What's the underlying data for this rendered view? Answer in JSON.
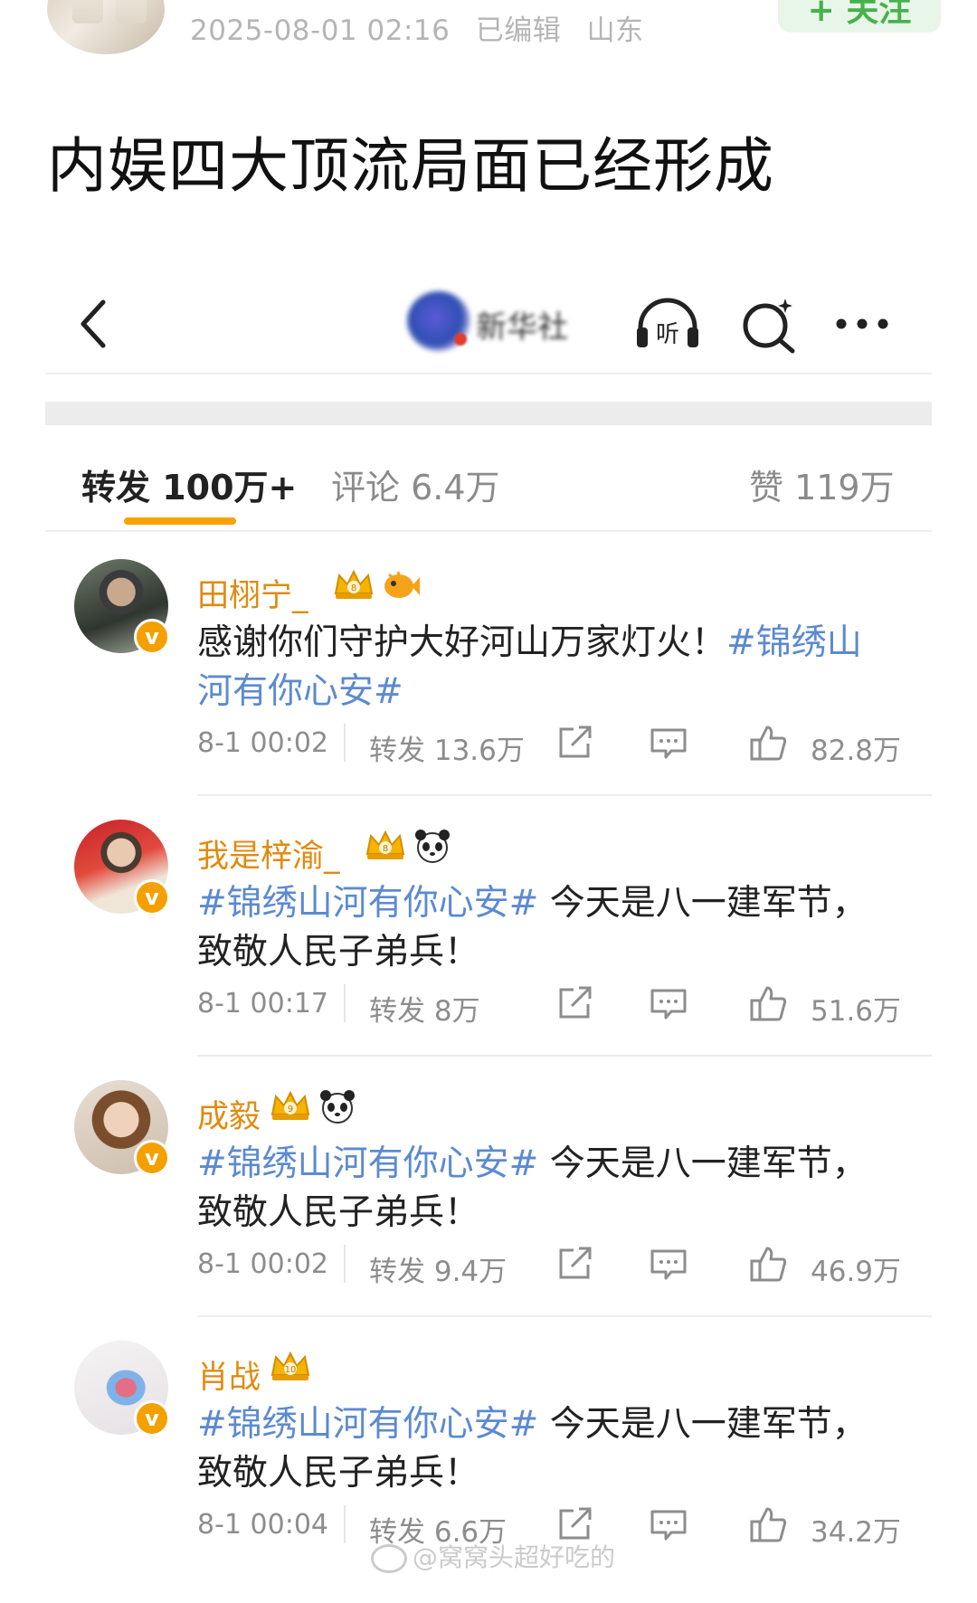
{
  "post": {
    "timestamp": "2025-08-01 02:16",
    "edited": "已编辑",
    "location": "山东",
    "follow_label": "+ 关注",
    "title": "内娱四大顶流局面已经形成"
  },
  "embedded_nav": {
    "account_name": "新华社",
    "listen_label": "听"
  },
  "tabs": {
    "repost": "转发 100万+",
    "comment": "评论 6.4万",
    "like": "赞 119万"
  },
  "reposts": [
    {
      "username": "田栩宁_",
      "level": "8",
      "verified_mark": "v",
      "text_parts": [
        {
          "text": "感谢你们守护大好河山万家灯火！",
          "is_tag": false
        },
        {
          "text": "#锦绣山河有你心安#",
          "is_tag": true
        }
      ],
      "time": "8-1 00:02",
      "repost_count": "转发 13.6万",
      "like_count": "82.8万"
    },
    {
      "username": "我是梓渝_",
      "level": "8",
      "verified_mark": "v",
      "text_parts": [
        {
          "text": "#锦绣山河有你心安#",
          "is_tag": true
        },
        {
          "text": " 今天是八一建军节，致敬人民子弟兵！",
          "is_tag": false
        }
      ],
      "time": "8-1 00:17",
      "repost_count": "转发 8万",
      "like_count": "51.6万"
    },
    {
      "username": "成毅",
      "level": "9",
      "verified_mark": "v",
      "text_parts": [
        {
          "text": "#锦绣山河有你心安#",
          "is_tag": true
        },
        {
          "text": " 今天是八一建军节，致敬人民子弟兵！",
          "is_tag": false
        }
      ],
      "time": "8-1 00:02",
      "repost_count": "转发 9.4万",
      "like_count": "46.9万"
    },
    {
      "username": "肖战",
      "level": "10",
      "verified_mark": "v",
      "text_parts": [
        {
          "text": "#锦绣山河有你心安#",
          "is_tag": true
        },
        {
          "text": " 今天是八一建军节，致敬人民子弟兵！",
          "is_tag": false
        }
      ],
      "time": "8-1 00:04",
      "repost_count": "转发 6.6万",
      "like_count": "34.2万"
    }
  ],
  "watermark": "@窝窝头超好吃的",
  "colors": {
    "tab_underline": "#f7a200",
    "username": "#e08b10",
    "hashtag": "#5c8ad1",
    "follow": "#46b24c",
    "verified_badge": "#f4a000"
  }
}
